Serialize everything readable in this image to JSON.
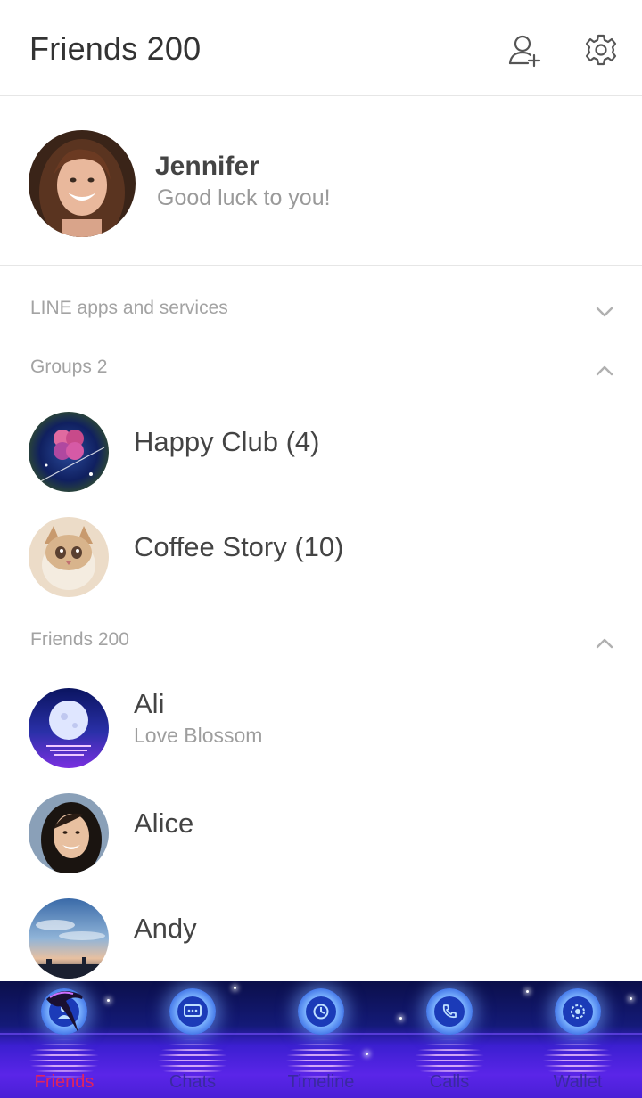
{
  "header": {
    "title": "Friends 200",
    "add_icon": "add-friend-icon",
    "settings_icon": "gear-icon"
  },
  "profile": {
    "name": "Jennifer",
    "status": "Good luck to you!"
  },
  "sections": {
    "services": {
      "label": "LINE apps and services",
      "state": "collapsed"
    },
    "groups": {
      "label": "Groups 2",
      "state": "expanded"
    },
    "friends": {
      "label": "Friends 200",
      "state": "expanded"
    }
  },
  "groups": [
    {
      "name": "Happy Club (4)"
    },
    {
      "name": "Coffee Story (10)"
    }
  ],
  "friends": [
    {
      "name": "Ali",
      "status": "Love Blossom"
    },
    {
      "name": "Alice"
    },
    {
      "name": "Andy"
    }
  ],
  "tabs": [
    {
      "label": "Friends",
      "icon": "person-icon",
      "active": true
    },
    {
      "label": "Chats",
      "icon": "chat-bubble-icon"
    },
    {
      "label": "Timeline",
      "icon": "clock-icon"
    },
    {
      "label": "Calls",
      "icon": "phone-icon"
    },
    {
      "label": "Wallet",
      "icon": "wallet-gear-icon"
    }
  ],
  "colors": {
    "active_tab": "#e0245e",
    "section_label": "#a3a3a3",
    "tabbar_base": "#4a1fd6"
  }
}
